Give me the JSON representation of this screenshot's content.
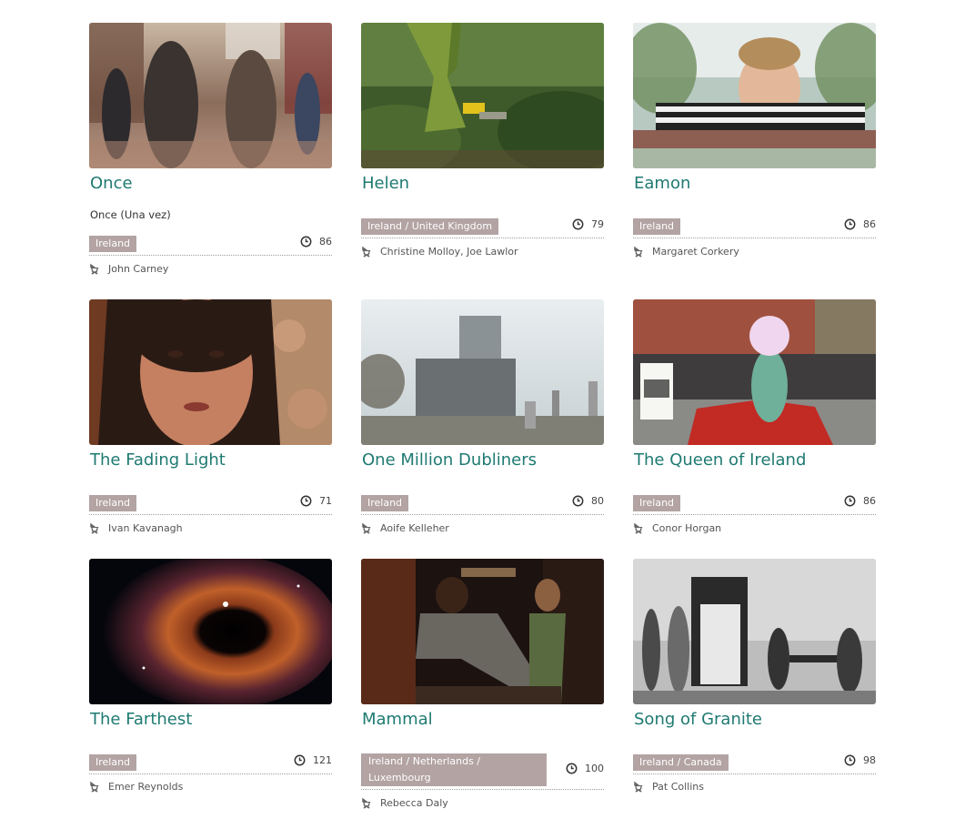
{
  "films": [
    {
      "title": "Once",
      "original_title": "Once (Una vez)",
      "country": "Ireland",
      "runtime": "86",
      "director": "John Carney"
    },
    {
      "title": "Helen",
      "country": "Ireland / United Kingdom",
      "runtime": "79",
      "director": "Christine Molloy, Joe Lawlor"
    },
    {
      "title": "Eamon",
      "country": "Ireland",
      "runtime": "86",
      "director": "Margaret Corkery"
    },
    {
      "title": "The Fading Light",
      "country": "Ireland",
      "runtime": "71",
      "director": "Ivan Kavanagh"
    },
    {
      "title": "One Million Dubliners",
      "country": "Ireland",
      "runtime": "80",
      "director": "Aoife Kelleher"
    },
    {
      "title": "The Queen of Ireland",
      "country": "Ireland",
      "runtime": "86",
      "director": "Conor Horgan"
    },
    {
      "title": "The Farthest",
      "country": "Ireland",
      "runtime": "121",
      "director": "Emer Reynolds"
    },
    {
      "title": "Mammal",
      "country": "Ireland / Netherlands / Luxembourg",
      "runtime": "100",
      "director": "Rebecca Daly"
    },
    {
      "title": "Song of Granite",
      "country": "Ireland / Canada",
      "runtime": "98",
      "director": "Pat Collins"
    }
  ],
  "icons": {
    "runtime": "clock-icon",
    "director": "director-chair-icon"
  },
  "colors": {
    "title": "#1f7a72",
    "country_badge": "#b3a3a3"
  }
}
